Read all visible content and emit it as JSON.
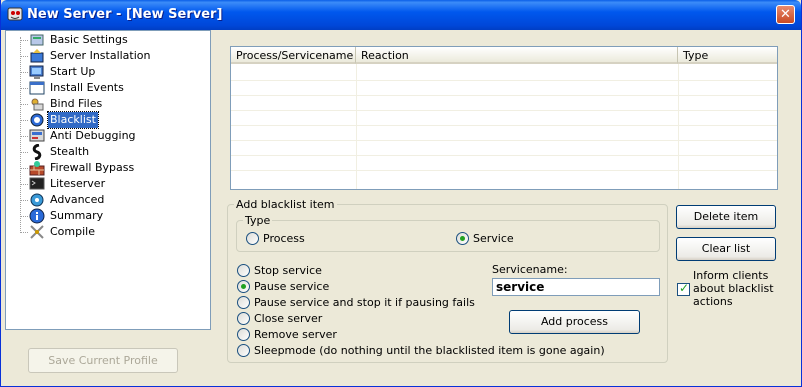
{
  "window": {
    "title": "New Server - [New Server]",
    "close_glyph": "✕"
  },
  "sidebar": {
    "items": [
      {
        "label": "Basic Settings",
        "icon": "settings-icon"
      },
      {
        "label": "Server Installation",
        "icon": "installation-icon"
      },
      {
        "label": "Start Up",
        "icon": "startup-icon"
      },
      {
        "label": "Install Events",
        "icon": "events-icon"
      },
      {
        "label": "Bind Files",
        "icon": "bind-files-icon"
      },
      {
        "label": "Blacklist",
        "icon": "blacklist-icon"
      },
      {
        "label": "Anti Debugging",
        "icon": "anti-debugging-icon"
      },
      {
        "label": "Stealth",
        "icon": "stealth-icon"
      },
      {
        "label": "Firewall Bypass",
        "icon": "firewall-icon"
      },
      {
        "label": "Liteserver",
        "icon": "liteserver-icon"
      },
      {
        "label": "Advanced",
        "icon": "advanced-icon"
      },
      {
        "label": "Summary",
        "icon": "summary-icon"
      },
      {
        "label": "Compile",
        "icon": "compile-icon"
      }
    ],
    "selected_index": 5,
    "save_profile_label": "Save Current Profile"
  },
  "list": {
    "columns": [
      "Process/Servicename",
      "Reaction",
      "Type"
    ],
    "rows": []
  },
  "add_item": {
    "group_label": "Add blacklist item",
    "type_label": "Type",
    "type_options": [
      "Process",
      "Service"
    ],
    "type_selected": "Service",
    "reaction_options": [
      "Stop service",
      "Pause service",
      "Pause service and stop it if pausing fails",
      "Close server",
      "Remove server",
      "Sleepmode (do nothing until the blacklisted item is gone again)"
    ],
    "reaction_selected": "Pause service",
    "servicename_label": "Servicename:",
    "servicename_value": "service",
    "add_button": "Add process"
  },
  "right_panel": {
    "delete_button": "Delete item",
    "clear_button": "Clear list",
    "inform_label_1": "Inform clients",
    "inform_label_2": "about blacklist",
    "inform_label_3": "actions",
    "inform_checked": true
  },
  "colors": {
    "titlebar": "#0058ee",
    "window_bg": "#ece9d8",
    "selection": "#316ac5",
    "radio_dot": "#21a121"
  }
}
